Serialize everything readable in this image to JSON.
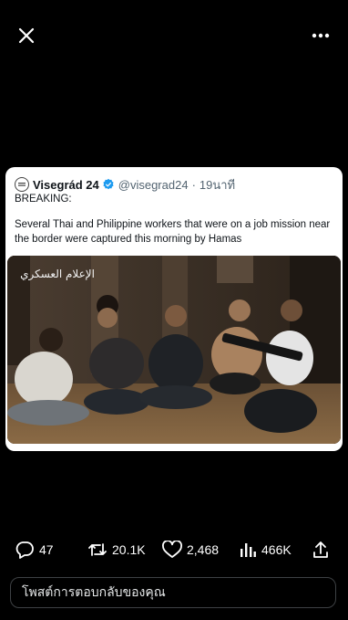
{
  "topbar": {
    "close_icon": "close-icon",
    "more_icon": "more-icon"
  },
  "quoted_post": {
    "author_name": "Visegrád 24",
    "verified": true,
    "handle": "@visegrad24",
    "separator": "·",
    "time": "19นาที",
    "line1": "BREAKING:",
    "line2": "Several Thai and Philippine workers that were on a job mission near the border were captured this morning by Hamas",
    "media_watermark": "الإعلام العسكري"
  },
  "actions": {
    "replies": "47",
    "reposts": "20.1K",
    "likes": "2,468",
    "views": "466K"
  },
  "reply": {
    "placeholder": "โพสต์การตอบกลับของคุณ"
  },
  "colors": {
    "background": "#000000",
    "card": "#ffffff",
    "verified": "#1d9bf0",
    "muted": "#536471"
  }
}
